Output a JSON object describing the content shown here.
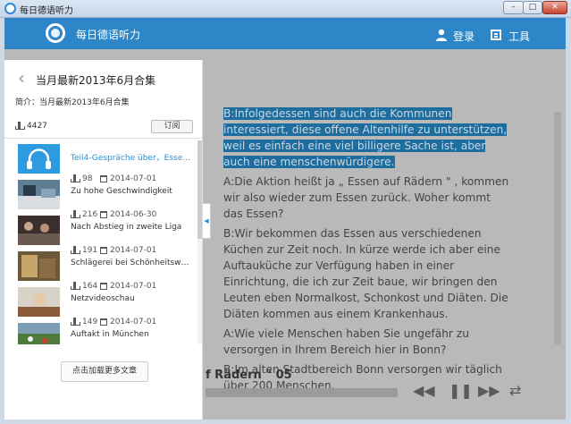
{
  "window": {
    "title": "每日德语听力",
    "min": "–",
    "max": "□",
    "close": "✕"
  },
  "header": {
    "app_name": "每日德语听力",
    "login": "登录",
    "tools": "工具"
  },
  "panel": {
    "back": "‹",
    "title": "当月最新2013年6月合集",
    "description": "简介：当月最新2013年6月合集",
    "downloads": "4427",
    "subscribe": "订阅",
    "load_more": "点击加载更多文章",
    "items": [
      {
        "title": "Teil4-Gespräche über，Essen a...",
        "downloads": "98",
        "date": "2014-07-01",
        "active": true
      },
      {
        "title": "Zu hohe Geschwindigkeit",
        "downloads": "216",
        "date": "2014-06-30"
      },
      {
        "title": "Nach Abstieg in zweite Liga",
        "downloads": "191",
        "date": "2014-07-01"
      },
      {
        "title": "Schlägerei bei Schönheitswettb...",
        "downloads": "164",
        "date": "2014-07-01"
      },
      {
        "title": "Netzvideoschau",
        "downloads": "149",
        "date": "2014-07-01"
      },
      {
        "title": "Auftakt in München",
        "downloads": "",
        "date": ""
      }
    ]
  },
  "article": {
    "paragraphs": [
      "B:Infolgedessen sind auch die Kommunen interessiert, diese offene Altenhilfe zu unterstützen, weil es einfach eine viel billigere Sache ist, aber auch eine menschenwürdigere.",
      "A:Die Aktion heißt ja „ Essen auf Rädern \" , kommen wir also wieder zum Essen zurück. Woher kommt das Essen?",
      "B:Wir bekommen das Essen aus verschiedenen Küchen zur Zeit noch. In kürze werde ich aber eine Auftauküche zur Verfügung haben in einer Einrichtung, die ich zur Zeit baue, wir bringen den Leuten eben Normalkost, Schonkost und Diäten. Die Diäten kommen aus einem Krankenhaus.",
      "A:Wie viele Menschen haben Sie ungefähr zu versorgen in Ihrem Bereich hier in Bonn?",
      "B:Im alten Stadtbereich Bonn versorgen wir täglich über 200 Menschen."
    ]
  },
  "player": {
    "now_playing": "f Rädern \" 05",
    "rewind": "◀◀",
    "pause": "❚❚",
    "forward": "▶▶",
    "repeat": "⇄"
  },
  "colors": {
    "accent": "#2c86c8",
    "highlight": "#1e6d9f",
    "link": "#2a8fd6"
  }
}
